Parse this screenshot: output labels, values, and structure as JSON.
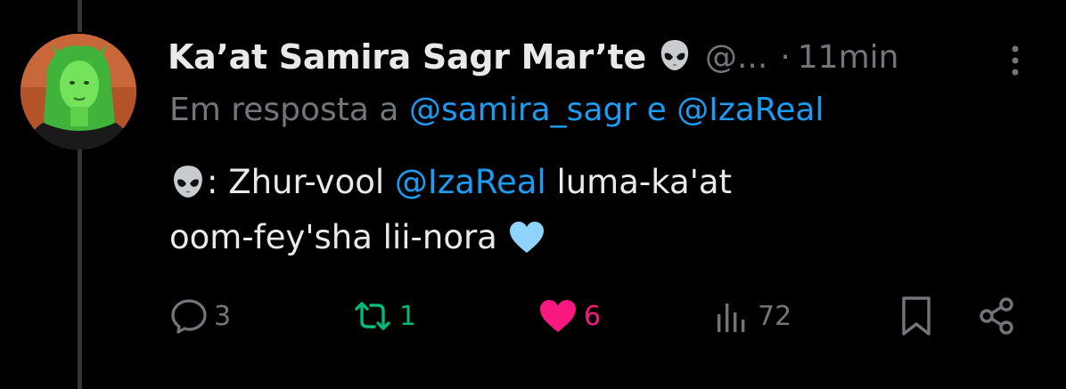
{
  "tweet": {
    "display_name": "Ka’at Samira Sagr Mar’te",
    "name_badge_icon": "alien-emoji",
    "handle": "@...",
    "separator": "·",
    "time": "11min",
    "reply_prefix": "Em resposta a",
    "reply_user_1": "@samira_sagr",
    "reply_joiner": "e",
    "reply_user_2": "@IzaReal",
    "body_prefix": ": Zhur-vool",
    "body_mention": "@IzaReal",
    "body_suffix_1": "luma-ka'at",
    "body_line_2": "oom-fey'sha lii-nora",
    "body_emoji": "light-blue-heart"
  },
  "actions": {
    "reply": {
      "icon": "reply-icon",
      "count": "3"
    },
    "repost": {
      "icon": "repost-icon",
      "count": "1"
    },
    "like": {
      "icon": "heart-icon",
      "count": "6"
    },
    "views": {
      "icon": "views-icon",
      "count": "72"
    },
    "bookmark": {
      "icon": "bookmark-icon"
    },
    "share": {
      "icon": "share-icon"
    }
  },
  "colors": {
    "background": "#000000",
    "text_primary": "#e7e9ea",
    "text_secondary": "#71767b",
    "link": "#1d9bf0",
    "repost": "#00ba7c",
    "like": "#f91880",
    "heart_emoji": "#8fd3ff"
  }
}
